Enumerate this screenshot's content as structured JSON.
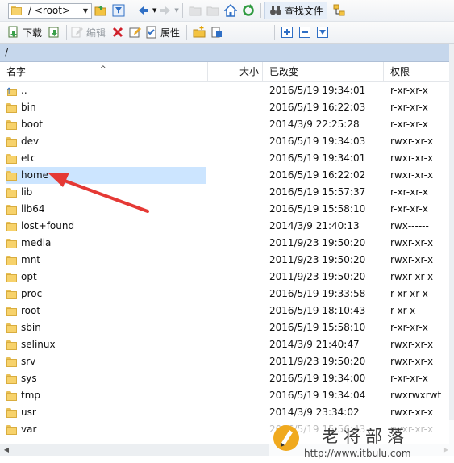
{
  "toolbar_top": {
    "path_value": "/ <root>",
    "find_files_label": "查找文件"
  },
  "toolbar_bottom": {
    "download_label": "下载",
    "edit_label": "编辑",
    "properties_label": "属性"
  },
  "address": {
    "path": "/"
  },
  "columns": {
    "name": "名字",
    "size": "大小",
    "modified": "已改变",
    "permissions": "权限"
  },
  "files": [
    {
      "name": "..",
      "date": "2016/5/19 19:34:01",
      "perm": "r-xr-xr-x",
      "type": "up"
    },
    {
      "name": "bin",
      "date": "2016/5/19 16:22:03",
      "perm": "r-xr-xr-x",
      "type": "folder"
    },
    {
      "name": "boot",
      "date": "2014/3/9 22:25:28",
      "perm": "r-xr-xr-x",
      "type": "folder"
    },
    {
      "name": "dev",
      "date": "2016/5/19 19:34:03",
      "perm": "rwxr-xr-x",
      "type": "folder"
    },
    {
      "name": "etc",
      "date": "2016/5/19 19:34:01",
      "perm": "rwxr-xr-x",
      "type": "folder"
    },
    {
      "name": "home",
      "date": "2016/5/19 16:22:02",
      "perm": "rwxr-xr-x",
      "type": "folder",
      "selected": true
    },
    {
      "name": "lib",
      "date": "2016/5/19 15:57:37",
      "perm": "r-xr-xr-x",
      "type": "folder"
    },
    {
      "name": "lib64",
      "date": "2016/5/19 15:58:10",
      "perm": "r-xr-xr-x",
      "type": "folder"
    },
    {
      "name": "lost+found",
      "date": "2014/3/9 21:40:13",
      "perm": "rwx------",
      "type": "folder"
    },
    {
      "name": "media",
      "date": "2011/9/23 19:50:20",
      "perm": "rwxr-xr-x",
      "type": "folder"
    },
    {
      "name": "mnt",
      "date": "2011/9/23 19:50:20",
      "perm": "rwxr-xr-x",
      "type": "folder"
    },
    {
      "name": "opt",
      "date": "2011/9/23 19:50:20",
      "perm": "rwxr-xr-x",
      "type": "folder"
    },
    {
      "name": "proc",
      "date": "2016/5/19 19:33:58",
      "perm": "r-xr-xr-x",
      "type": "folder"
    },
    {
      "name": "root",
      "date": "2016/5/19 18:10:43",
      "perm": "r-xr-x---",
      "type": "folder"
    },
    {
      "name": "sbin",
      "date": "2016/5/19 15:58:10",
      "perm": "r-xr-xr-x",
      "type": "folder"
    },
    {
      "name": "selinux",
      "date": "2014/3/9 21:40:47",
      "perm": "rwxr-xr-x",
      "type": "folder"
    },
    {
      "name": "srv",
      "date": "2011/9/23 19:50:20",
      "perm": "rwxr-xr-x",
      "type": "folder"
    },
    {
      "name": "sys",
      "date": "2016/5/19 19:34:00",
      "perm": "r-xr-xr-x",
      "type": "folder"
    },
    {
      "name": "tmp",
      "date": "2016/5/19 19:34:04",
      "perm": "rwxrwxrwt",
      "type": "folder"
    },
    {
      "name": "usr",
      "date": "2014/3/9 23:34:02",
      "perm": "rwxr-xr-x",
      "type": "folder"
    },
    {
      "name": "var",
      "date": "2016/5/19 15:56:43",
      "perm": "rwxr-xr-x",
      "type": "folder"
    }
  ],
  "watermark": {
    "title": "老将部落",
    "url": "http://www.itbulu.com"
  },
  "colors": {
    "address_bar": "#c6d7ec",
    "selection": "#cce5ff",
    "annotation_arrow": "#e53935",
    "folder": "#f7d26b"
  }
}
